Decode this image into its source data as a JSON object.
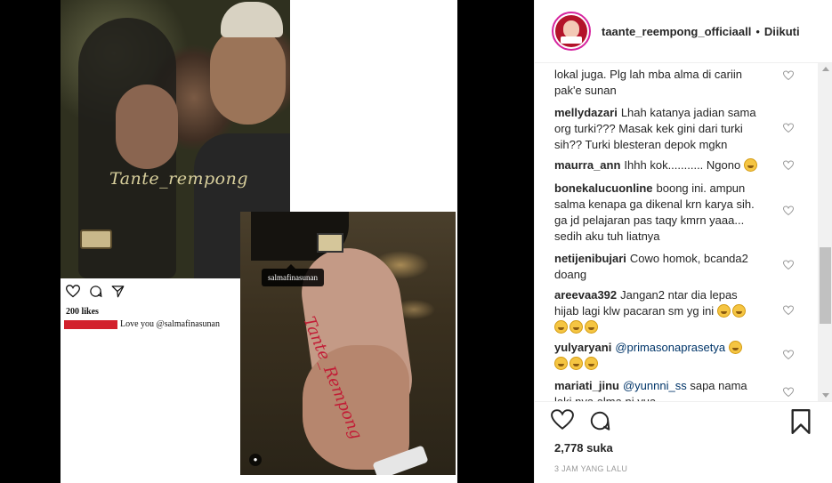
{
  "post": {
    "username": "taante_reempong_officiaall",
    "separator": "•",
    "follow_status": "Diikuti",
    "likes": "2,778 suka",
    "timestamp": "3 JAM YANG LALU"
  },
  "image_overlay": {
    "watermark": "Tante_rempong",
    "inner_likes": "200 likes",
    "inner_caption": "Love you @salmafinasunan",
    "tag_label": "salmafinasunan",
    "handwriting": "Tante_Rempong"
  },
  "comments": [
    {
      "user": "",
      "text": "lokal juga. Plg lah mba alma di cariin",
      "text2": "pak'e sunan"
    },
    {
      "user": "mellydazari",
      "text": "Lhah katanya jadian sama",
      "text2": "org turki??? Masak kek gini dari turki",
      "text3": "sih?? Turki blesteran depok mgkn"
    },
    {
      "user": "maurra_ann",
      "text": "Ihhh kok........... Ngono"
    },
    {
      "user": "bonekalucuonline",
      "text": "boong ini. ampun",
      "text2": "salma kenapa ga dikenal krn karya sih.",
      "text3": "ga jd pelajaran pas taqy kmrn yaaa...",
      "text4": "sedih aku tuh liatnya"
    },
    {
      "user": "netijenibujari",
      "text": "Cowo homok, bcanda2",
      "text2": "doang"
    },
    {
      "user": "areevaa392",
      "text": "Jangan2 ntar dia lepas",
      "text2": "hijab lagi klw pacaran sm yg ini"
    },
    {
      "user": "yulyaryani",
      "mention": "@primasonaprasetya"
    },
    {
      "user": "mariati_jinu",
      "mention": "@yunnni_ss",
      "text": "sapa nama",
      "text2": "laki nya alma ni yua"
    }
  ],
  "icons": {
    "like": "heart-icon",
    "comment": "comment-icon",
    "share": "share-icon",
    "save": "bookmark-icon"
  },
  "colors": {
    "mention": "#003569",
    "avatar_ring": "#d6249f",
    "redaction": "#d2202c"
  }
}
